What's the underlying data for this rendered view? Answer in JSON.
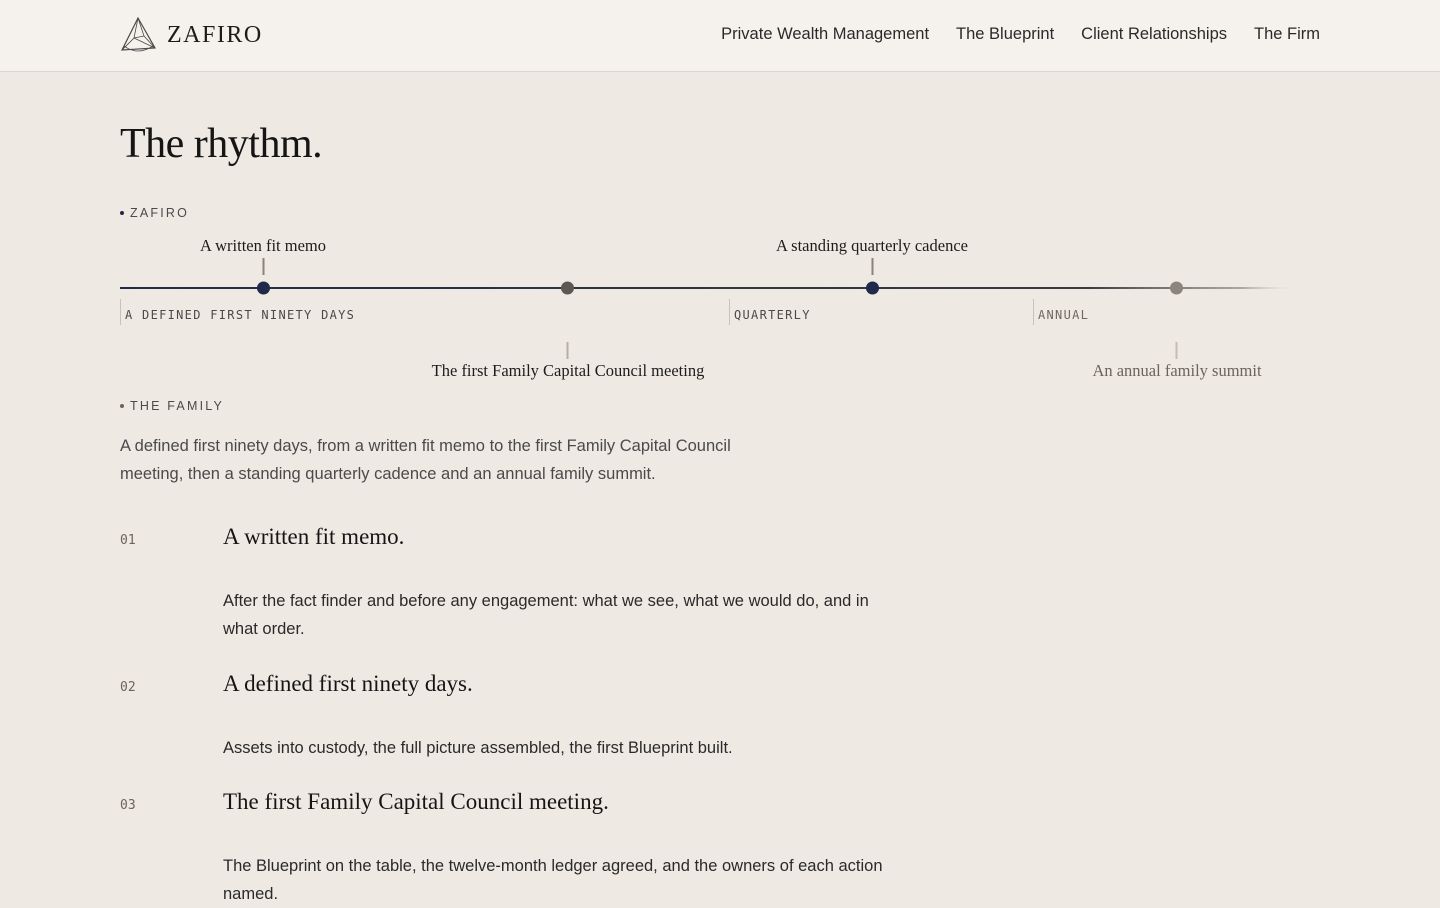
{
  "header": {
    "brand": "ZAFIRO",
    "logo_icon": "triangle-gem-icon",
    "nav": [
      {
        "label": "Private Wealth Management"
      },
      {
        "label": "The Blueprint"
      },
      {
        "label": "Client Relationships"
      },
      {
        "label": "The Firm"
      }
    ]
  },
  "page": {
    "title": "The rhythm."
  },
  "timeline": {
    "top_track_label": "ZAFIRO",
    "bottom_track_label": "THE FAMILY",
    "events_top": [
      {
        "label": "A written fit memo"
      },
      {
        "label": "A standing quarterly cadence"
      }
    ],
    "events_bottom": [
      {
        "label": "The first Family Capital Council meeting"
      },
      {
        "label": "An annual family summit"
      }
    ],
    "phases": [
      {
        "label": "A DEFINED FIRST NINETY DAYS"
      },
      {
        "label": "QUARTERLY"
      },
      {
        "label": "ANNUAL"
      }
    ],
    "colors": {
      "accent": "#1f2a4a",
      "muted_node": "#8b847d",
      "line": "#1f2a4a"
    }
  },
  "summary": "A defined first ninety days, from a written fit memo to the first Family Capital Council meeting, then a standing quarterly cadence and an annual family summit.",
  "steps": [
    {
      "number": "01",
      "title": "A written fit memo.",
      "description": "After the fact finder and before any engagement: what we see, what we would do, and in what order."
    },
    {
      "number": "02",
      "title": "A defined first ninety days.",
      "description": "Assets into custody, the full picture assembled, the first Blueprint built."
    },
    {
      "number": "03",
      "title": "The first Family Capital Council meeting.",
      "description": "The Blueprint on the table, the twelve-month ledger agreed, and the owners of each action named."
    }
  ]
}
